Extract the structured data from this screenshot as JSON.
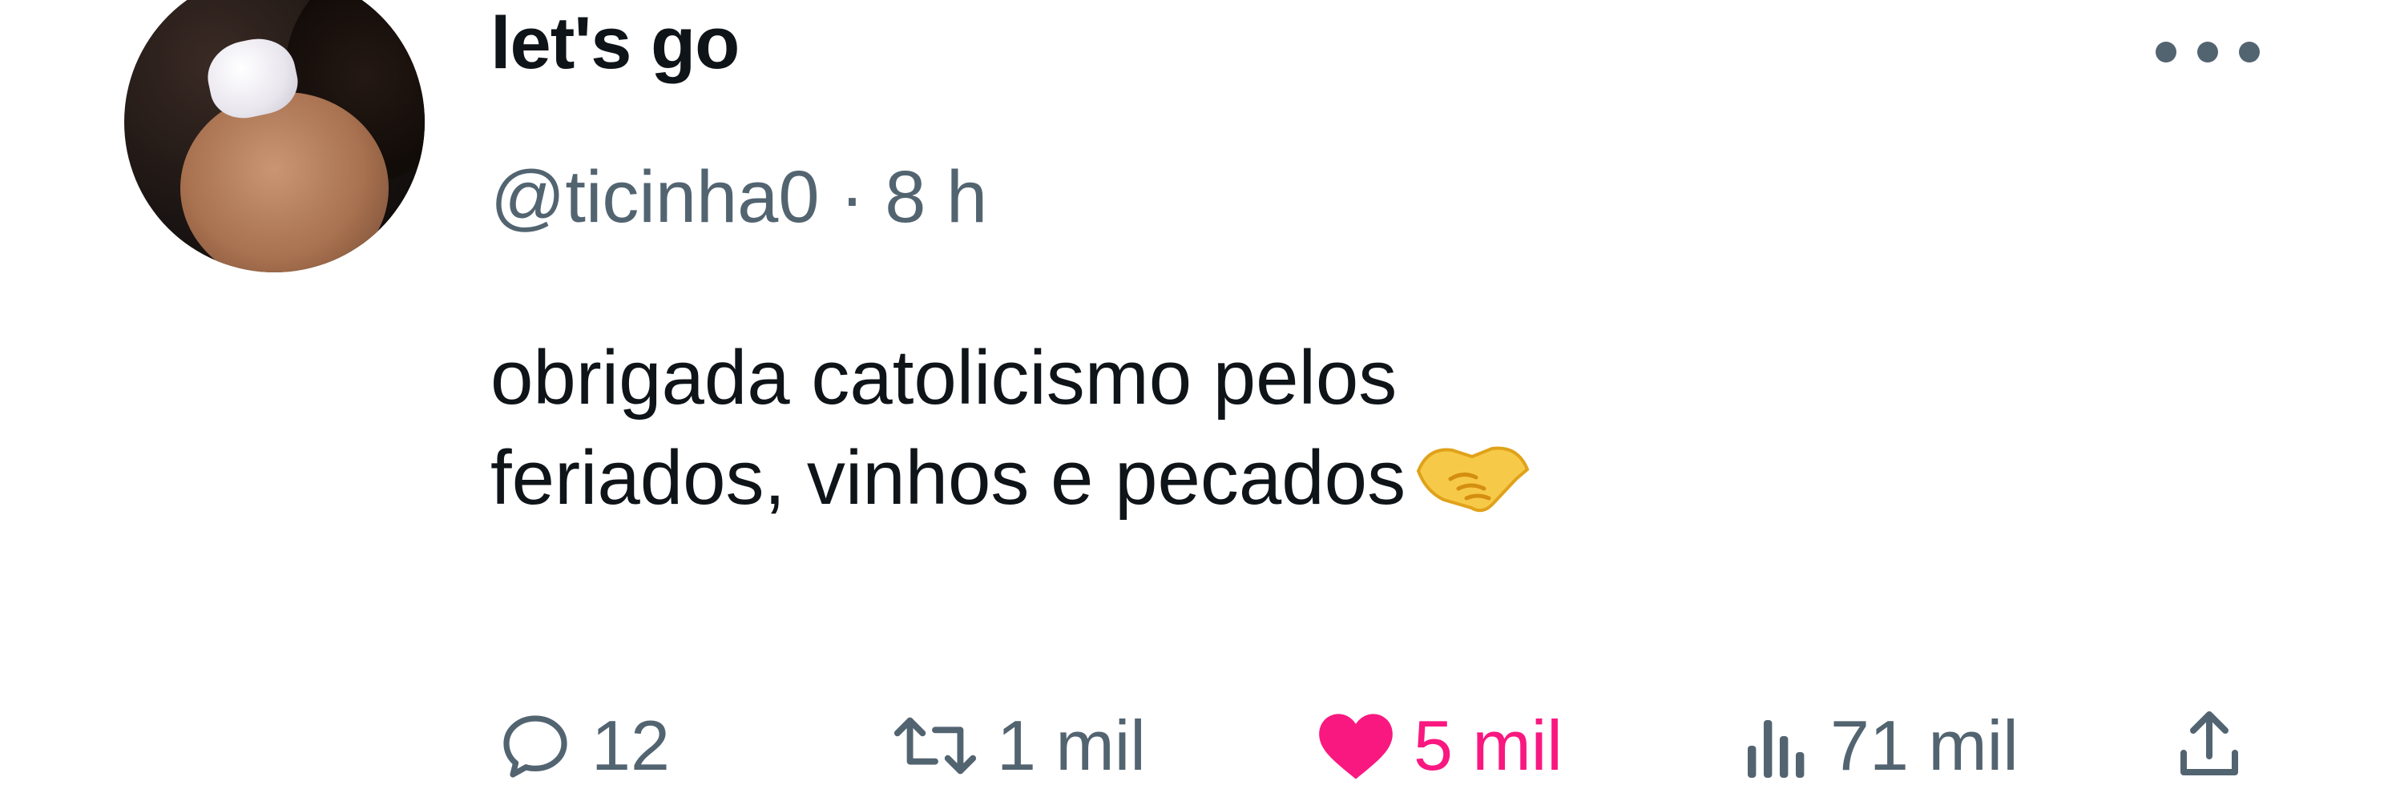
{
  "tweet": {
    "display_name": "let's go",
    "handle": "@ticinha0",
    "separator": "·",
    "time": "8 h",
    "text_lines": [
      "obrigada catolicismo pelos",
      "feriados, vinhos e pecados"
    ],
    "emoji": "handshake-emoji",
    "more_icon": "more-options-icon"
  },
  "actions": {
    "reply": {
      "icon": "reply-icon",
      "count": "12"
    },
    "retweet": {
      "icon": "retweet-icon",
      "count": "1 mil"
    },
    "like": {
      "icon": "heart-icon",
      "count": "5 mil",
      "active": true,
      "color": "#f91880"
    },
    "views": {
      "icon": "views-icon",
      "count": "71 mil"
    },
    "share": {
      "icon": "share-icon"
    }
  },
  "colors": {
    "text": "#0f1419",
    "secondary": "#536471",
    "like": "#f91880",
    "background": "#ffffff"
  }
}
